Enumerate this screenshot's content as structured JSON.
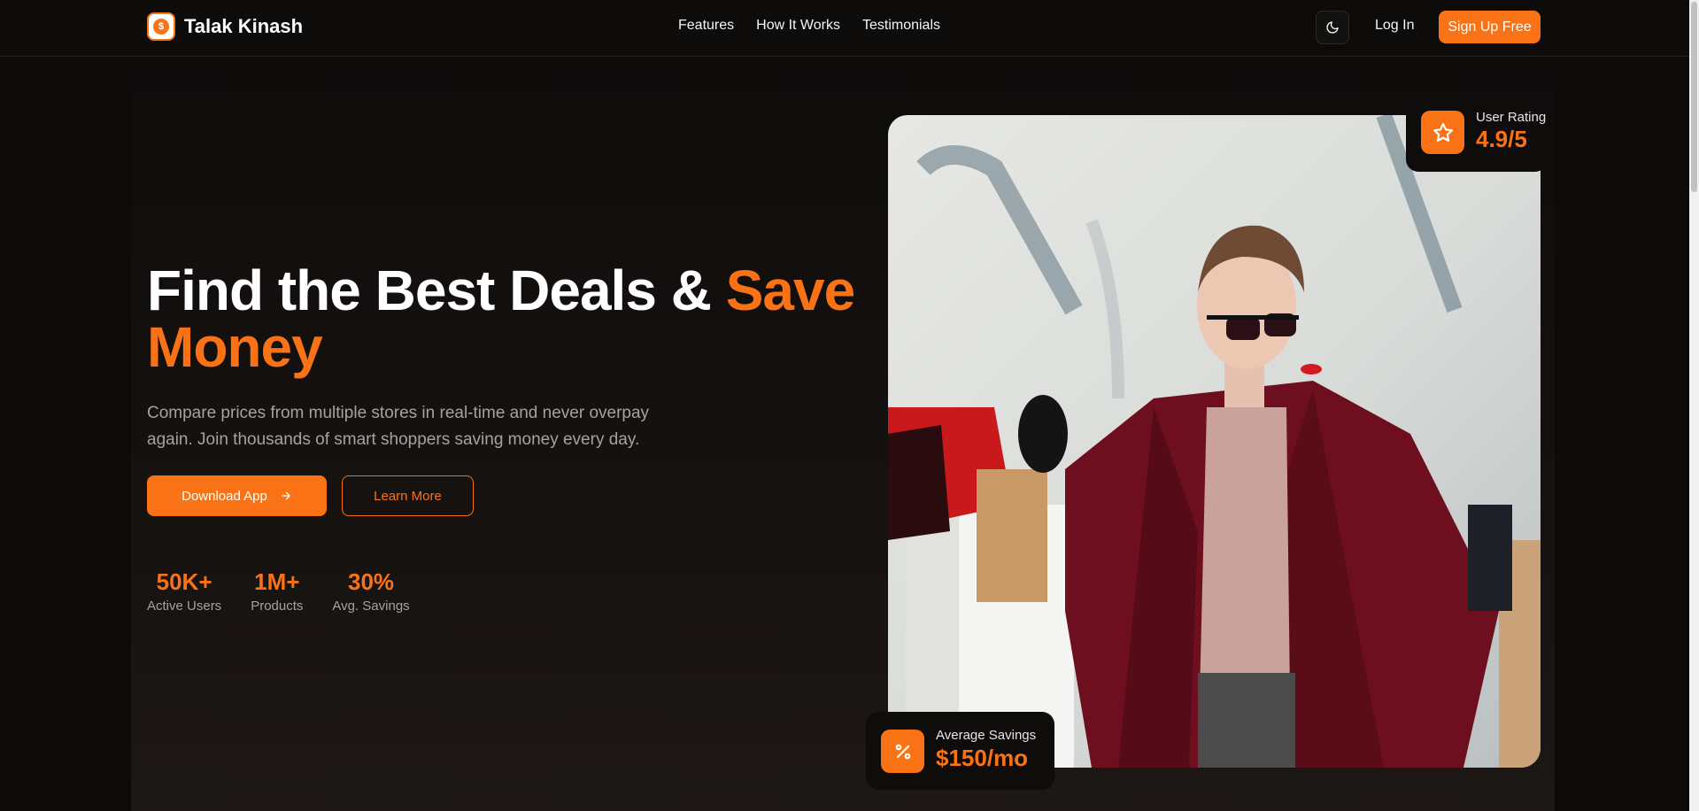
{
  "brand": {
    "name": "Talak Kinash",
    "logo_glyph": "$"
  },
  "nav": {
    "links": [
      "Features",
      "How It Works",
      "Testimonials"
    ],
    "login": "Log In",
    "signup": "Sign Up Free",
    "theme_icon": "moon-icon"
  },
  "hero": {
    "headline_main": "Find the Best Deals & ",
    "headline_accent": "Save Money",
    "subtitle": "Compare prices from multiple stores in real-time and never overpay again. Join thousands of smart shoppers saving money every day.",
    "primary_button": "Download App",
    "secondary_button": "Learn More",
    "stats": [
      {
        "value": "50K+",
        "label": "Active Users"
      },
      {
        "value": "1M+",
        "label": "Products"
      },
      {
        "value": "30%",
        "label": "Avg. Savings"
      }
    ]
  },
  "cards": {
    "rating_label": "User Rating",
    "rating_value": "4.9/5",
    "savings_label": "Average Savings",
    "savings_value": "$150/mo"
  },
  "colors": {
    "accent": "#f97316",
    "background": "#0c0b0a"
  }
}
